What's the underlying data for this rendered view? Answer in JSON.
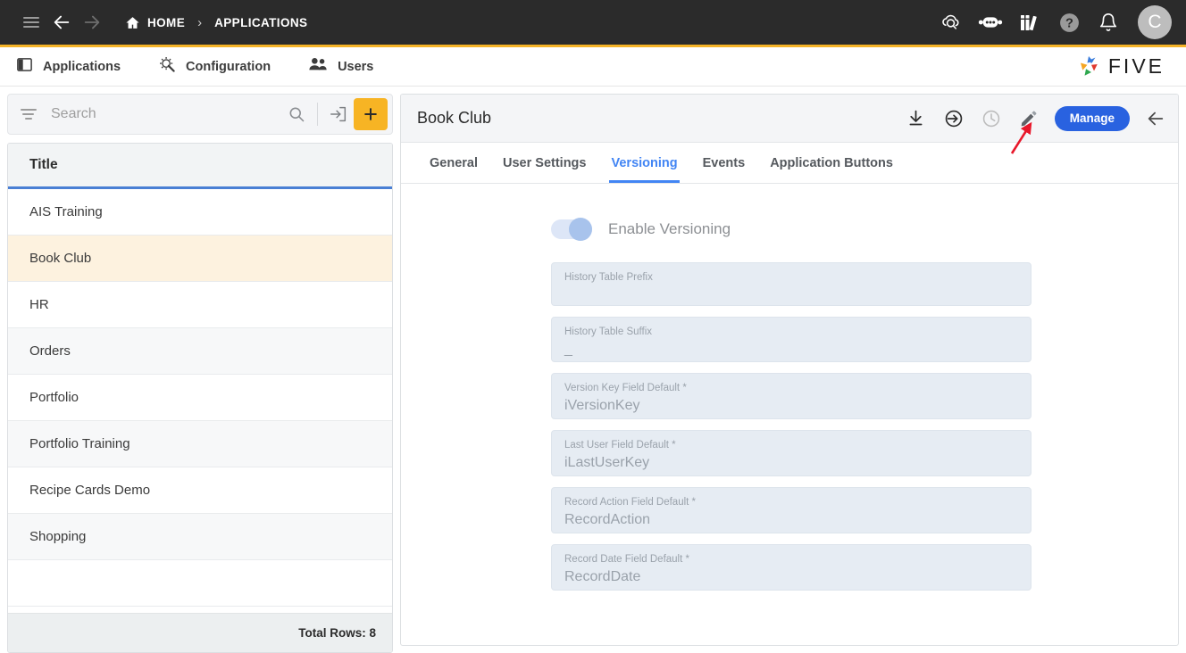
{
  "topbar": {
    "menu_icon": "hamburger-icon",
    "back_icon": "arrow-left-icon",
    "forward_icon": "arrow-right-icon",
    "breadcrumb": {
      "home_label": "HOME",
      "separator": "›",
      "current_label": "APPLICATIONS"
    },
    "actions": [
      {
        "name": "cloud-check-icon",
        "label": ""
      },
      {
        "name": "robot-icon",
        "label": ""
      },
      {
        "name": "books-icon",
        "label": ""
      },
      {
        "name": "help-icon",
        "label": ""
      },
      {
        "name": "bell-icon",
        "label": ""
      }
    ],
    "avatar_initial": "C"
  },
  "subnav": {
    "items": [
      {
        "label": "Applications",
        "icon": "panel-icon"
      },
      {
        "label": "Configuration",
        "icon": "gear-wrench-icon"
      },
      {
        "label": "Users",
        "icon": "users-icon"
      }
    ],
    "logo_text": "FIVE"
  },
  "sidebar": {
    "search": {
      "placeholder": "Search",
      "value": ""
    },
    "filter_icon": "filter-icon",
    "search_icon": "search-icon",
    "import_icon": "import-icon",
    "add_icon": "plus-icon",
    "table": {
      "column_header": "Title",
      "rows": [
        {
          "title": "AIS Training",
          "selected": false
        },
        {
          "title": "Book Club",
          "selected": true
        },
        {
          "title": "HR",
          "selected": false
        },
        {
          "title": "Orders",
          "selected": false
        },
        {
          "title": "Portfolio",
          "selected": false
        },
        {
          "title": "Portfolio Training",
          "selected": false
        },
        {
          "title": "Recipe Cards Demo",
          "selected": false
        },
        {
          "title": "Shopping",
          "selected": false
        }
      ],
      "footer": "Total Rows: 8"
    }
  },
  "main": {
    "title": "Book Club",
    "actions": [
      {
        "name": "download-icon"
      },
      {
        "name": "deploy-icon"
      },
      {
        "name": "history-clock-icon"
      },
      {
        "name": "edit-pencil-icon"
      }
    ],
    "manage_label": "Manage",
    "close_icon": "arrow-left-icon",
    "tabs": [
      {
        "label": "General",
        "active": false
      },
      {
        "label": "User Settings",
        "active": false
      },
      {
        "label": "Versioning",
        "active": true
      },
      {
        "label": "Events",
        "active": false
      },
      {
        "label": "Application Buttons",
        "active": false
      }
    ],
    "form": {
      "toggle": {
        "label": "Enable Versioning",
        "checked": true
      },
      "fields": [
        {
          "label": "History Table Prefix",
          "value": ""
        },
        {
          "label": "History Table Suffix",
          "value": "_"
        },
        {
          "label": "Version Key Field Default *",
          "value": "iVersionKey"
        },
        {
          "label": "Last User Field Default *",
          "value": "iLastUserKey"
        },
        {
          "label": "Record Action Field Default *",
          "value": "RecordAction"
        },
        {
          "label": "Record Date Field Default *",
          "value": "RecordDate"
        }
      ]
    }
  },
  "annotation": {
    "type": "red-arrow",
    "points_to": "edit-pencil-icon",
    "color": "#e8172a"
  },
  "colors": {
    "topbar_bg": "#2b2b2b",
    "accent_yellow": "#f5b327",
    "tab_active": "#4285f4",
    "manage_blue": "#2962e0",
    "row_selected": "#fdf2df",
    "field_bg": "#e6ecf3"
  }
}
